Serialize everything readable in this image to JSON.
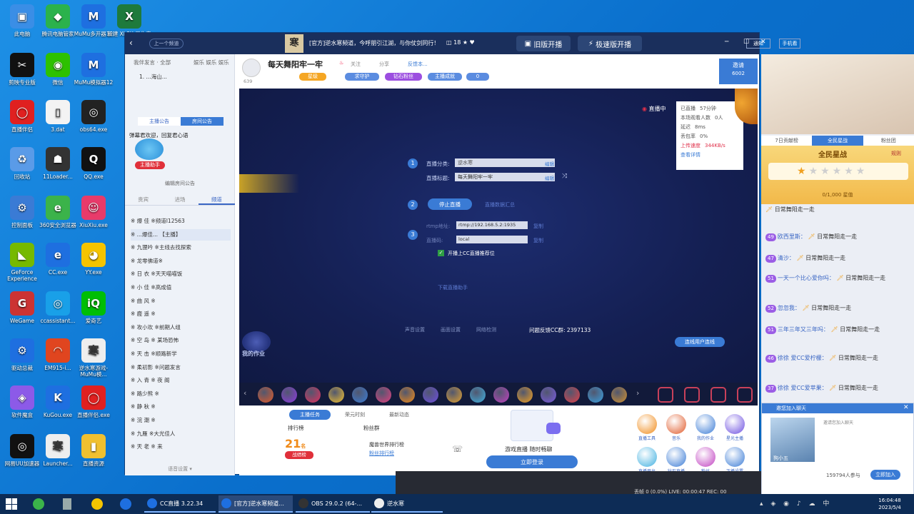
{
  "desktop": {
    "icons": [
      {
        "label": "此电脑",
        "color": "#3a8ee6",
        "glyph": "▣"
      },
      {
        "label": "腾讯电脑管家",
        "color": "#2bb24c",
        "glyph": "◆"
      },
      {
        "label": "MuMu多开器12",
        "color": "#1e6fe0",
        "glyph": "M"
      },
      {
        "label": "新建 XLSX 工作表",
        "color": "#1e7a3c",
        "glyph": "X"
      },
      {
        "label": "剪映专业版",
        "color": "#111",
        "glyph": "✂"
      },
      {
        "label": "微信",
        "color": "#2dc100",
        "glyph": "◉"
      },
      {
        "label": "MuMu模拟器12",
        "color": "#1e6fe0",
        "glyph": "M"
      },
      {
        "label": "直播伴侣",
        "color": "#e02020",
        "glyph": "◯"
      },
      {
        "label": "3.dat",
        "color": "#f3f3f3",
        "glyph": "▯"
      },
      {
        "label": "obs64.exe",
        "color": "#222",
        "glyph": "◎"
      },
      {
        "label": "回收站",
        "color": "#5a9be8",
        "glyph": "♻"
      },
      {
        "label": "11Loader...",
        "color": "#333",
        "glyph": "☗"
      },
      {
        "label": "QQ.exe",
        "color": "#111",
        "glyph": "Q"
      },
      {
        "label": "控制面板",
        "color": "#3a7bd5",
        "glyph": "⚙"
      },
      {
        "label": "360安全浏览器",
        "color": "#3bb34a",
        "glyph": "e"
      },
      {
        "label": "XiuXiu.exe",
        "color": "#e83a6a",
        "glyph": "☺"
      },
      {
        "label": "GeForce Experience",
        "color": "#76b900",
        "glyph": "◣"
      },
      {
        "label": "CC.exe",
        "color": "#1e6fe0",
        "glyph": "e"
      },
      {
        "label": "YY.exe",
        "color": "#f5c400",
        "glyph": "◕"
      },
      {
        "label": "WeGame",
        "color": "#c33",
        "glyph": "G"
      },
      {
        "label": "ccassistant...",
        "color": "#19a0e8",
        "glyph": "◎"
      },
      {
        "label": "爱奇艺",
        "color": "#00be06",
        "glyph": "iQ"
      },
      {
        "label": "驱动总裁",
        "color": "#1e6fe0",
        "glyph": "⚙"
      },
      {
        "label": "EM915-i...",
        "color": "#e0451f",
        "glyph": "◠"
      },
      {
        "label": "逆水寒游戏-MuMu模...",
        "color": "#eee",
        "glyph": "寒"
      },
      {
        "label": "软件魔盒",
        "color": "#8c5ae8",
        "glyph": "◈"
      },
      {
        "label": "KuGou.exe",
        "color": "#1e6fe0",
        "glyph": "K"
      },
      {
        "label": "直播伴侣.exe",
        "color": "#e02020",
        "glyph": "◯"
      },
      {
        "label": "网易UU加速器",
        "color": "#111",
        "glyph": "◎"
      },
      {
        "label": "Launcher...",
        "color": "#eee",
        "glyph": "寒"
      },
      {
        "label": "直播资源",
        "color": "#f0c030",
        "glyph": "▮"
      }
    ]
  },
  "window": {
    "back": "‹",
    "prev_label": "上一个频道",
    "banner": "[官方]逆水寒频道，今呼朋引江湖，与你仗剑同行！",
    "count": "18",
    "btn_old": "旧版开播",
    "btn_fast": "极速版开播",
    "notify": "通知",
    "phone": "手机看",
    "min": "─",
    "max": "☐",
    "close": "✕"
  },
  "leftpanel": {
    "top_tabs": [
      "我伴发言 · 全部",
      "娱乐 娱乐 娱乐"
    ],
    "user_row": "1. ...海山...",
    "announce_tabs": [
      "主播公告",
      "房间公告"
    ],
    "welcome": "弹幕君欢迎，回复君心语",
    "helper": "主播助手",
    "edit_notice": "编辑房间公告",
    "list_tabs": [
      "频道",
      "贵宾",
      "进场"
    ],
    "list": [
      "※ 爆 佳 ※频道I12563",
      "※ ...爆佳... 【主播】",
      "※ 九狸吟  ※主线去找探索",
      "※ 龙零佛道※",
      "※ 日 衣 ※天天喵喵饭",
      "※ 小 佳 ※高成值",
      "※ 曲 风 ※",
      "※ 鹿 遥 ※",
      "※ 攻小欢 ※前期人组",
      "※ 空 岛 ※ 某场恐怖",
      "※ 天 击 ※顺路新学",
      "※ 柔初影 ※问题发言",
      "※ 入 青 ※ 夜 阁",
      "※ 路少熊 ※",
      "※ 静 秋 ※",
      "※ 浣 潮 ※",
      "※ 九雁 ※大光佳人",
      "※ 天 老 ※ 来"
    ],
    "footer": "语音设置 ▾"
  },
  "stream": {
    "title": "每天舞阳牢一牢",
    "fans": "639",
    "follow": "关注",
    "share": "分享",
    "more": "反馈本...",
    "tags": [
      "星级",
      "求守护",
      "钻石粉丝",
      "主播成就",
      "0"
    ],
    "invite_label": "邀请",
    "invite_count": "6002",
    "live_label": "直播中",
    "stats": [
      [
        "已直播",
        "57分钟"
      ],
      [
        "本场观看人数",
        "0人"
      ],
      [
        "延迟",
        "8ms"
      ],
      [
        "丢包率",
        "0%"
      ],
      [
        "上传速度",
        "344KB/s"
      ],
      [
        "查看详情",
        ""
      ]
    ],
    "step1_cat_label": "直播分类:",
    "step1_cat_value": "逆水寒",
    "edit": "编辑",
    "step1_title_label": "直播标题:",
    "step1_title_value": "每天舞阳牢一牢",
    "stop_btn": "停止直播",
    "live_data": "直播数据汇总",
    "rtmp_label": "rtmp地址:",
    "rtmp_value": "rtmp://192.168.5.2:1935",
    "copy": "复制",
    "code_label": "直播码:",
    "code_value": "local",
    "cc_check": "开播上CC直播推荐位",
    "download": "下载直播助手",
    "bottom_tools": [
      "声音设置",
      "画面设置",
      "网络检测"
    ],
    "feedback": "问题反馈CC群: 2397133",
    "connect": "连线用户连线",
    "watermark": "我的作业"
  },
  "bottom": {
    "tabs": [
      "主播任务",
      "荣元时刻",
      "最新动态"
    ],
    "rank_label": "排行榜",
    "fans_label": "粉丝群",
    "rank_num": "21",
    "rank_unit": "名",
    "rank_badge": "战绩榜",
    "world": "魔兽世界排行榜",
    "fans_link": "粉丝排行榜",
    "promo": "游戏直播 随时畅聊",
    "login": "立即登录",
    "tools": [
      "直播工具",
      "音乐",
      "我的作业",
      "星光主播",
      "直播平台",
      "钻石直播",
      "粉丝",
      "下播设置"
    ],
    "obs_status": "丢帧 0 (0.0%)  LIVE: 00:00:47  REC: 00"
  },
  "chat": {
    "rank_tabs": [
      "7日贡献榜",
      "全民星战",
      "粉丝团"
    ],
    "star_title": "全民星战",
    "star_progress": "0/1,000 星值",
    "star_rule": "规则",
    "messages": [
      {
        "lvl": "",
        "name": "",
        "text": "日常舞阳走一走"
      },
      {
        "lvl": "49",
        "name": "欧西里斯：",
        "text": "日常舞阳走一走"
      },
      {
        "lvl": "47",
        "name": "清沙：",
        "text": "日常舞阳走一走"
      },
      {
        "lvl": "51",
        "name": "一天一个比心爱你吗：",
        "text": "日常舞阳走一走"
      },
      {
        "lvl": "52",
        "name": "忽忽我：",
        "text": "日常舞阳走一走"
      },
      {
        "lvl": "51",
        "name": "三年三年又三年吗：",
        "text": "日常舞阳走一走"
      },
      {
        "lvl": "46",
        "name": "徐徐 爱CC爱柠檬：",
        "text": "日常舞阳走一走"
      },
      {
        "lvl": "37",
        "name": "徐徐 爱CC爱苹果：",
        "text": "日常舞阳走一走"
      }
    ],
    "popup_title": "邀您加入聊天",
    "popup_user": "狗小五",
    "popup_note": "邀请您加入聊天",
    "popup_count": "159794人参与",
    "popup_join": "立即加入"
  },
  "taskbar": {
    "items": [
      "CC直播 3.22.34",
      "[官方]逆水寒频道...",
      "OBS 29.0.2 (64-...",
      "逆水寒"
    ],
    "time": "16:04:48",
    "date": "2023/5/4"
  }
}
